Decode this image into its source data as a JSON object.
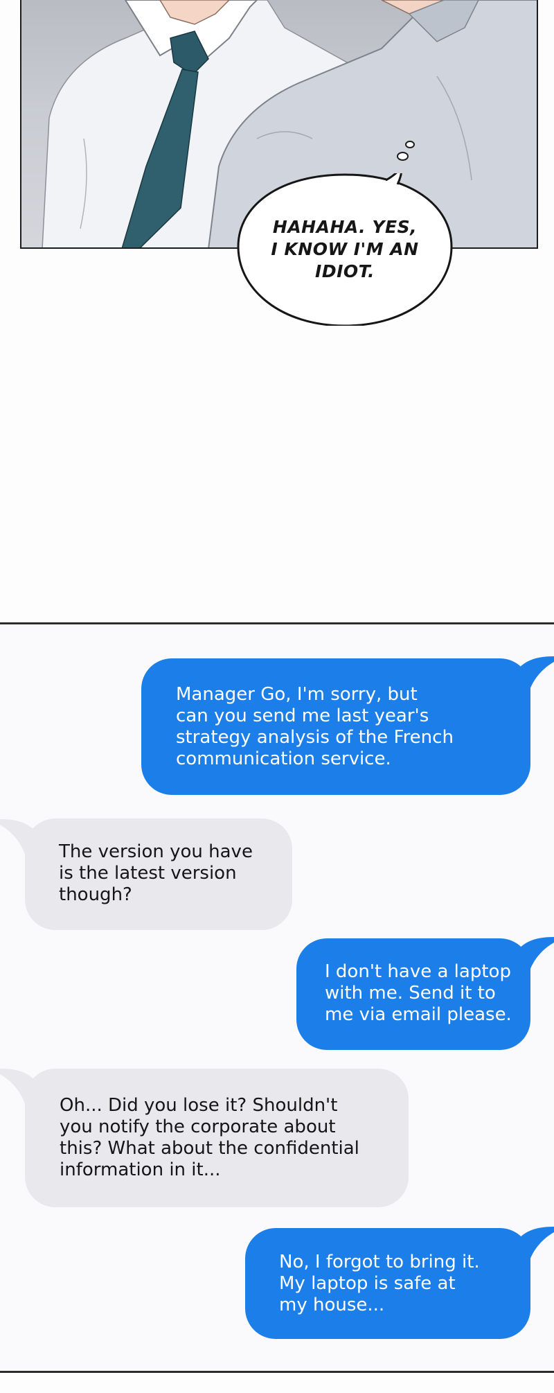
{
  "panel": {
    "speech_lines": [
      "HAHAHA. YES,",
      "I KNOW I'M AN",
      "IDIOT."
    ]
  },
  "chat": {
    "colors": {
      "outgoing": "#1c7fe9",
      "incoming": "#e8e8ed"
    },
    "messages": [
      {
        "side": "outgoing",
        "lines": [
          "Manager Go, I'm sorry, but",
          "can you send me last year's",
          "strategy analysis of the French",
          "communication service."
        ]
      },
      {
        "side": "incoming",
        "lines": [
          "The version you have",
          "is the latest version",
          "though?"
        ]
      },
      {
        "side": "outgoing",
        "lines": [
          "I don't have a laptop",
          "with me. Send it to",
          "me via email please."
        ]
      },
      {
        "side": "incoming",
        "lines": [
          "Oh... Did you lose it? Shouldn't",
          "you notify the corporate about",
          "this? What about the confidential",
          "information in it..."
        ]
      },
      {
        "side": "outgoing",
        "lines": [
          "No, I forgot to bring it.",
          "My laptop is safe at",
          "my house..."
        ]
      }
    ]
  }
}
